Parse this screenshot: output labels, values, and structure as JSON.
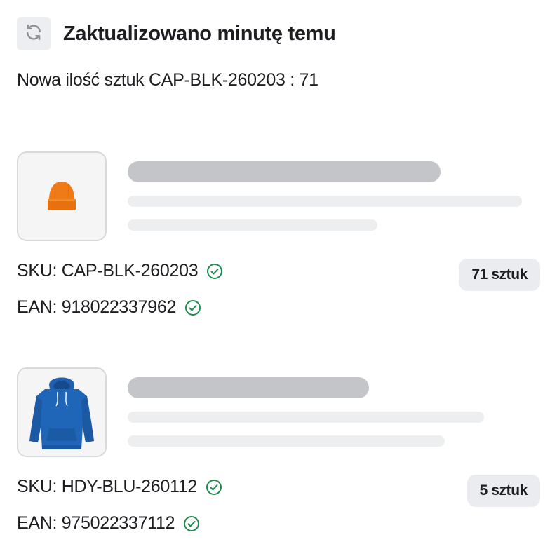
{
  "header": {
    "title": "Zaktualizowano minutę temu",
    "refresh_icon": "refresh-icon"
  },
  "message": "Nowa ilość sztuk CAP-BLK-260203 : 71",
  "products": [
    {
      "image": "orange-beanie",
      "sku_label": "SKU: CAP-BLK-260203",
      "ean_label": "EAN: 918022337962",
      "quantity": "71 sztuk",
      "sku_verified": true,
      "ean_verified": true
    },
    {
      "image": "blue-hoodie",
      "sku_label": "SKU: HDY-BLU-260112",
      "ean_label": "EAN: 975022337112",
      "quantity": "5 sztuk",
      "sku_verified": true,
      "ean_verified": true
    }
  ],
  "colors": {
    "check": "#1e8a4c",
    "skeleton_dark": "#c3c5c9",
    "skeleton_light": "#eceef0",
    "badge_bg": "#ebecef"
  }
}
